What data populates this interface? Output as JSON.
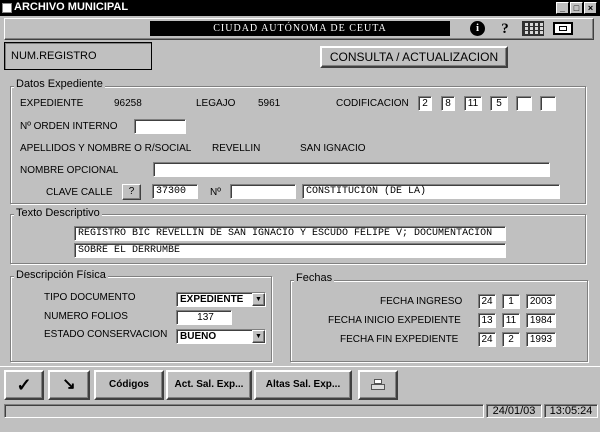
{
  "window": {
    "title": "ARCHIVO MUNICIPAL",
    "controls": [
      "_",
      "□",
      "×"
    ]
  },
  "header": {
    "city": "CIUDAD AUTÓNOMA DE CEUTA",
    "icons": [
      "info-icon",
      "help-icon",
      "calculator-icon",
      "resize-icon"
    ],
    "info_glyph": "i",
    "help_glyph": "?"
  },
  "top": {
    "num_registro_label": "NUM.REGISTRO",
    "consulta_button": "CONSULTA / ACTUALIZACION"
  },
  "expediente": {
    "legend": "Datos Expediente",
    "expediente_label": "EXPEDIENTE",
    "expediente_value": "96258",
    "legajo_label": "LEGAJO",
    "legajo_value": "5961",
    "codificacion_label": "CODIFICACION",
    "codificacion": [
      "2",
      "8",
      "11",
      "5",
      "",
      ""
    ],
    "orden_label": "Nº ORDEN INTERNO",
    "orden_value": "",
    "apellidos_label": "APELLIDOS Y NOMBRE O R/SOCIAL",
    "apellidos_value1": "REVELLIN",
    "apellidos_value2": "SAN IGNACIO",
    "nombre_opcional_label": "NOMBRE OPCIONAL",
    "nombre_opcional_value": "",
    "clave_calle_label": "CLAVE CALLE",
    "clave_help": "?",
    "clave_calle_value": "37300",
    "numero_label": "Nº",
    "numero_value": "",
    "calle_value": "CONSTITUCION (DE LA)"
  },
  "texto": {
    "legend": "Texto Descriptivo",
    "line1": "REGISTRO BIC REVELLIN DE SAN IGNACIO Y ESCUDO FELIPE V; DOCUMENTACION",
    "line2": "SOBRE EL DERRUMBE"
  },
  "fisica": {
    "legend": "Descripción Física",
    "tipo_label": "TIPO DOCUMENTO",
    "tipo_value": "EXPEDIENTE",
    "folios_label": "NUMERO FOLIOS",
    "folios_value": "137",
    "estado_label": "ESTADO CONSERVACION",
    "estado_value": "BUENO"
  },
  "fechas": {
    "legend": "Fechas",
    "ingreso_label": "FECHA INGRESO",
    "ingreso": [
      "24",
      "1",
      "2003"
    ],
    "inicio_label": "FECHA INICIO EXPEDIENTE",
    "inicio": [
      "13",
      "11",
      "1984"
    ],
    "fin_label": "FECHA FIN EXPEDIENTE",
    "fin": [
      "24",
      "2",
      "1993"
    ]
  },
  "toolbar": {
    "codigos": "Códigos",
    "act_sal": "Act. Sal. Exp...",
    "altas_sal": "Altas Sal. Exp...",
    "icons": [
      "check-icon",
      "wand-icon",
      "printer-icon"
    ]
  },
  "status": {
    "date": "24/01/03",
    "time": "13:05:24"
  }
}
